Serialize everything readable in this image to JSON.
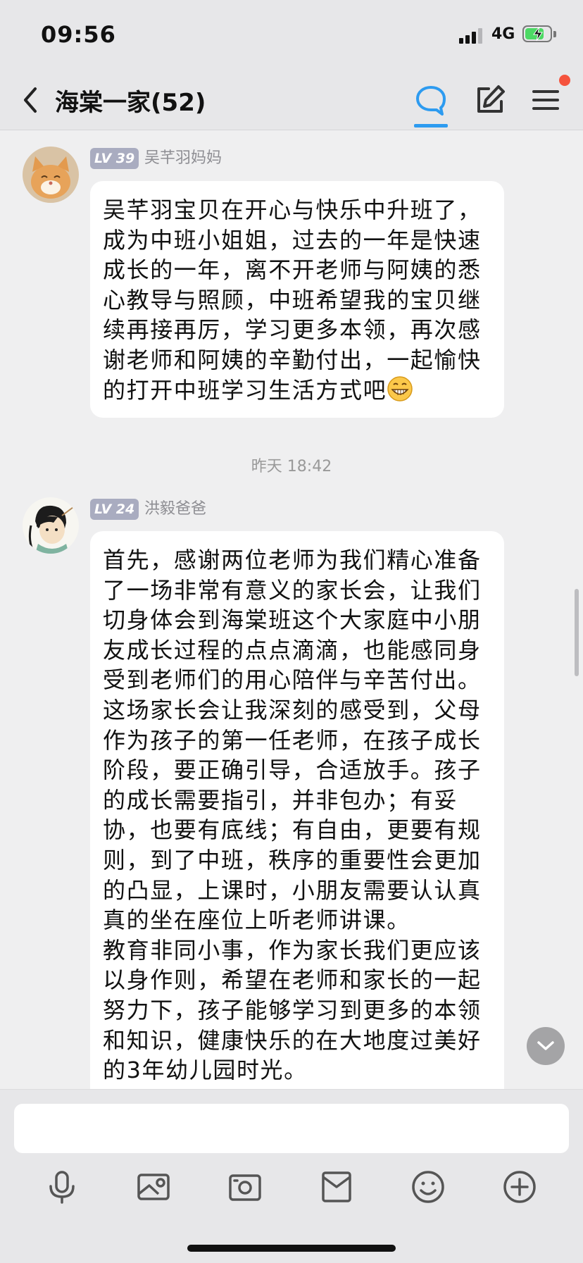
{
  "status_bar": {
    "time": "09:56",
    "network": "4G"
  },
  "nav": {
    "title": "海棠一家(52)"
  },
  "messages": [
    {
      "level": "LV 39",
      "sender": "吴芊羽妈妈",
      "text": "吴芊羽宝贝在开心与快乐中升班了，成为中班小姐姐，过去的一年是快速成长的一年，离不开老师与阿姨的悉心教导与照顾，中班希望我的宝贝继续再接再厉，学习更多本领，再次感谢老师和阿姨的辛勤付出，一起愉快的打开中班学习生活方式吧"
    },
    {
      "level": "LV 24",
      "sender": "洪毅爸爸",
      "text": "首先，感谢两位老师为我们精心准备了一场非常有意义的家长会，让我们切身体会到海棠班这个大家庭中小朋友成长过程的点点滴滴，也能感同身受到老师们的用心陪伴与辛苦付出。\n这场家长会让我深刻的感受到，父母作为孩子的第一任老师，在孩子成长阶段，要正确引导，合适放手。孩子的成长需要指引，并非包办；有妥协，也要有底线；有自由，更要有规则，到了中班，秩序的重要性会更加的凸显，上课时，小朋友需要认认真真的坐在座位上听老师讲课。\n教育非同小事，作为家长我们更应该以身作则，希望在老师和家长的一起努力下，孩子能够学习到更多的本领和知识，健康快乐的在大地度过美好的3年幼儿园时光。"
    }
  ],
  "timestamp": "昨天 18:42",
  "input": {
    "value": ""
  },
  "toolbar": [
    "microphone-icon",
    "photo-icon",
    "camera-icon",
    "envelope-icon",
    "emoji-icon",
    "plus-icon"
  ],
  "colors": {
    "accent": "#2d9bf0",
    "notification": "#f5533d",
    "badge": "#a9acc0",
    "battery": "#4cd964"
  }
}
